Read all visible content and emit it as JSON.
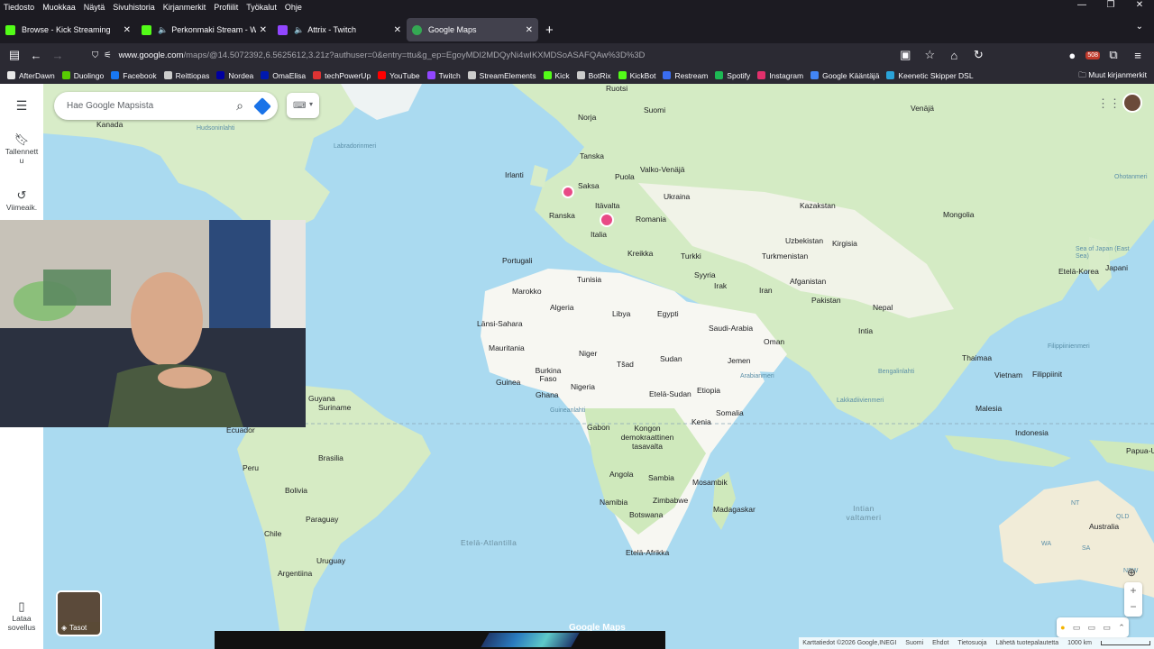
{
  "menubar": {
    "items": [
      "Tiedosto",
      "Muokkaa",
      "Näytä",
      "Sivuhistoria",
      "Kirjanmerkit",
      "Profiilit",
      "Työkalut",
      "Ohje"
    ]
  },
  "window_controls": {
    "minimize": "—",
    "restore": "❐",
    "close": "✕"
  },
  "tabs": [
    {
      "title": "Browse - Kick Streaming",
      "color": "#53fc18",
      "active": false
    },
    {
      "title": "Perkonmaki Stream - Watch",
      "color": "#53fc18",
      "active": false
    },
    {
      "title": "Attrix - Twitch",
      "color": "#9146ff",
      "active": false
    },
    {
      "title": "Google Maps",
      "color": "#34a853",
      "active": true
    }
  ],
  "navbar": {
    "url_domain": "www.google.com",
    "url_rest": "/maps/@14.5072392,6.5625612,3.21z?authuser=0&entry=ttu&g_ep=EgoyMDI2MDQyNi4wIKXMDSoASAFQAw%3D%3D",
    "badge": "508"
  },
  "bookmarks": [
    {
      "label": "AfterDawn",
      "color": "#e8e8e8"
    },
    {
      "label": "Duolingo",
      "color": "#58cc02"
    },
    {
      "label": "Facebook",
      "color": "#1877f2"
    },
    {
      "label": "Reittiopas",
      "color": "#cccccc"
    },
    {
      "label": "Nordea",
      "color": "#0000a0"
    },
    {
      "label": "OmaElisa",
      "color": "#0019af"
    },
    {
      "label": "techPowerUp",
      "color": "#d33"
    },
    {
      "label": "YouTube",
      "color": "#ff0000"
    },
    {
      "label": "Twitch",
      "color": "#9146ff"
    },
    {
      "label": "StreamElements",
      "color": "#cccccc"
    },
    {
      "label": "Kick",
      "color": "#53fc18"
    },
    {
      "label": "BotRix",
      "color": "#cccccc"
    },
    {
      "label": "KickBot",
      "color": "#53fc18"
    },
    {
      "label": "Restream",
      "color": "#3a6df0"
    },
    {
      "label": "Spotify",
      "color": "#1db954"
    },
    {
      "label": "Instagram",
      "color": "#e1306c"
    },
    {
      "label": "Google Kääntäjä",
      "color": "#4285f4"
    },
    {
      "label": "Keenetic Skipper DSL",
      "color": "#2aa3d8"
    }
  ],
  "bookmarks_other": "Muut kirjanmerkit",
  "sidebar": {
    "saved": "Tallennett u",
    "recent": "Viimeaik.",
    "download": "Lataa sovellus"
  },
  "search": {
    "placeholder": "Hae Google Mapsista"
  },
  "layers_label": "Tasot",
  "map_labels": [
    "Ruotsi",
    "Suomi",
    "Norja",
    "Venäjä",
    "Kanada",
    "Hudsoninlahti",
    "Labradorinmeri",
    "Tanska",
    "Irlanti",
    "Valko-Venäjä",
    "Puola",
    "Saksa",
    "Ukraina",
    "Itävalta",
    "Kazakstan",
    "Ranska",
    "Romania",
    "Mongolia",
    "Italia",
    "Uzbekistan",
    "Kirgisia",
    "Portugali",
    "Kreikka",
    "Turkki",
    "Turkmenistan",
    "Syyria",
    "Afganistan",
    "Tunisia",
    "Marokko",
    "Irak",
    "Iran",
    "Algeria",
    "Libya",
    "Egypti",
    "Pakistan",
    "Nepal",
    "Länsi-Sahara",
    "Saudi-Arabia",
    "Oman",
    "Intia",
    "Mauritania",
    "Niger",
    "Sudan",
    "Tšad",
    "Jemen",
    "Burkina Faso",
    "Nigeria",
    "Guinea",
    "Ghana",
    "Etelä-Sudan",
    "Etiopia",
    "Guyana",
    "Suriname",
    "Somalia",
    "Kenia",
    "Gabon",
    "Kongon demokraattinen tasavalta",
    "Ecuador",
    "Peru",
    "Brasilia",
    "Bolivia",
    "Angola",
    "Sambia",
    "Mosambik",
    "Namibia",
    "Zimbabwe",
    "Madagaskar",
    "Botswana",
    "Paraguay",
    "Chile",
    "Uruguay",
    "Argentiina",
    "Etelä-Afrikka",
    "Etelä-Korea",
    "Japani",
    "Thaimaa",
    "Vietnam",
    "Filippiinit",
    "Malesia",
    "Indonesia",
    "Papua-Uusi-Guinea",
    "Australia",
    "Arabianmeri",
    "Bengalinlahti",
    "Lakkadiivienmeri",
    "Guineanlahti",
    "Filippiinienmeri",
    "Etelä-Atlantilla",
    "Intian valtameri",
    "Sea of Japan (East Sea)",
    "Ohotanmeri",
    "NT",
    "QLD",
    "NSW",
    "WA",
    "SA",
    "Google Maps"
  ],
  "attribution": [
    "Karttatiedot ©2026 Google,INEGI",
    "Suomi",
    "Ehdot",
    "Tietosuoja",
    "Lähetä tuotepalautetta",
    "1000 km"
  ]
}
